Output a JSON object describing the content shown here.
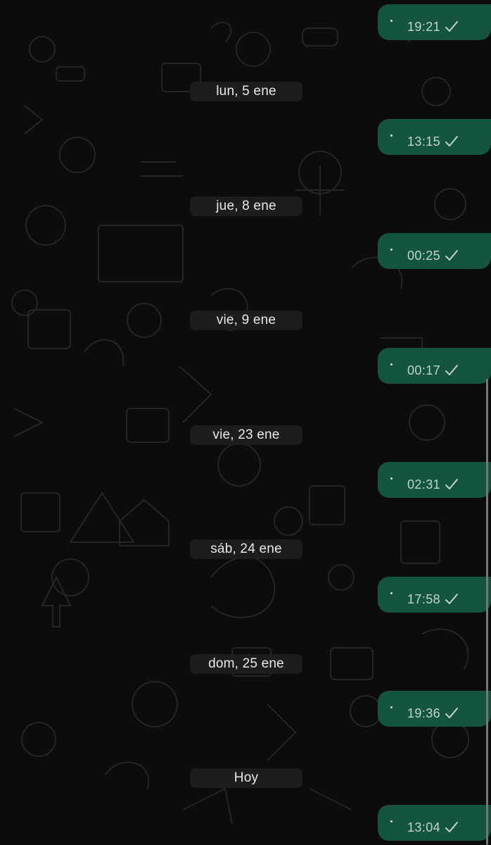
{
  "chat": {
    "date_separators": [
      {
        "label": "lun, 5 ene"
      },
      {
        "label": "jue, 8 ene"
      },
      {
        "label": "vie, 9 ene"
      },
      {
        "label": "vie, 23 ene"
      },
      {
        "label": "sáb, 24 ene"
      },
      {
        "label": "dom, 25 ene"
      },
      {
        "label": "Hoy"
      }
    ],
    "messages": [
      {
        "time": "19:21",
        "status": "sent"
      },
      {
        "time": "13:15",
        "status": "sent"
      },
      {
        "time": "00:25",
        "status": "sent"
      },
      {
        "time": "00:17",
        "status": "sent"
      },
      {
        "time": "02:31",
        "status": "sent"
      },
      {
        "time": "17:58",
        "status": "sent"
      },
      {
        "time": "19:36",
        "status": "sent"
      },
      {
        "time": "13:04",
        "status": "sent"
      }
    ]
  },
  "colors": {
    "background": "#0c0c0c",
    "outgoing_bubble": "#13553e",
    "date_pill": "#1d1d1d",
    "timestamp": "#c2d4cc",
    "date_text": "#e9e9e9"
  },
  "icons": {
    "message_status": "single-check-icon",
    "wallpaper": "doodle-pattern"
  }
}
